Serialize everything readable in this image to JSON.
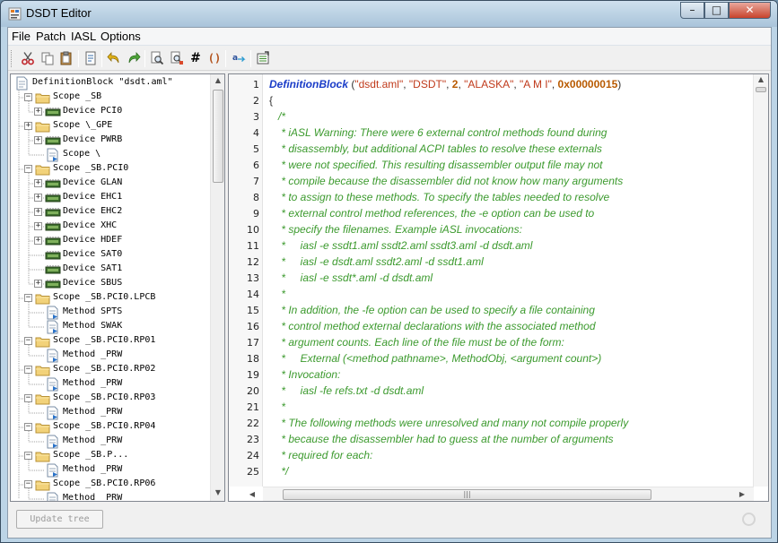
{
  "window": {
    "title": "DSDT Editor",
    "min_glyph": "–",
    "max_glyph": "□",
    "close_glyph": "✕"
  },
  "menu": [
    "File",
    "Patch",
    "IASL",
    "Options"
  ],
  "toolbar": {
    "icons": [
      "cut-icon",
      "copy-icon",
      "paste-icon",
      "compile-icon",
      "undo-icon",
      "redo-icon",
      "find-icon",
      "find-replace-icon",
      "hash-icon",
      "braces-icon",
      "spellcheck-icon",
      "patch-icon"
    ],
    "hash_glyph": "#",
    "braces_glyph": "()"
  },
  "tree": [
    {
      "label": "DefinitionBlock \"dsdt.aml\"",
      "kind": "root",
      "expander": "-"
    },
    {
      "label": "Scope _SB",
      "kind": "folder",
      "expander": "-"
    },
    {
      "label": "Device PCI0",
      "kind": "device",
      "expander": "+"
    },
    {
      "label": "Scope \\_GPE",
      "kind": "folder",
      "expander": "+"
    },
    {
      "label": "Device PWRB",
      "kind": "device",
      "expander": "+"
    },
    {
      "label": "Scope \\",
      "kind": "method",
      "expander": ""
    },
    {
      "label": "Scope _SB.PCI0",
      "kind": "folder",
      "expander": "-"
    },
    {
      "label": "Device GLAN",
      "kind": "device",
      "expander": "+"
    },
    {
      "label": "Device EHC1",
      "kind": "device",
      "expander": "+"
    },
    {
      "label": "Device EHC2",
      "kind": "device",
      "expander": "+"
    },
    {
      "label": "Device XHC",
      "kind": "device",
      "expander": "+"
    },
    {
      "label": "Device HDEF",
      "kind": "device",
      "expander": "+"
    },
    {
      "label": "Device SAT0",
      "kind": "device",
      "expander": ""
    },
    {
      "label": "Device SAT1",
      "kind": "device",
      "expander": ""
    },
    {
      "label": "Device SBUS",
      "kind": "device",
      "expander": "+"
    },
    {
      "label": "Scope _SB.PCI0.LPCB",
      "kind": "folder",
      "expander": "-"
    },
    {
      "label": "Method SPTS",
      "kind": "method",
      "expander": ""
    },
    {
      "label": "Method SWAK",
      "kind": "method",
      "expander": ""
    },
    {
      "label": "Scope _SB.PCI0.RP01",
      "kind": "folder",
      "expander": "-"
    },
    {
      "label": "Method _PRW",
      "kind": "method",
      "expander": ""
    },
    {
      "label": "Scope _SB.PCI0.RP02",
      "kind": "folder",
      "expander": "-"
    },
    {
      "label": "Method _PRW",
      "kind": "method",
      "expander": ""
    },
    {
      "label": "Scope _SB.PCI0.RP03",
      "kind": "folder",
      "expander": "-"
    },
    {
      "label": "Method _PRW",
      "kind": "method",
      "expander": ""
    },
    {
      "label": "Scope _SB.PCI0.RP04",
      "kind": "folder",
      "expander": "-"
    },
    {
      "label": "Method _PRW",
      "kind": "method",
      "expander": ""
    },
    {
      "label": "Scope _SB.P...",
      "kind": "folder",
      "expander": "-"
    },
    {
      "label": "Method _PRW",
      "kind": "method",
      "expander": ""
    },
    {
      "label": "Scope _SB.PCI0.RP06",
      "kind": "folder",
      "expander": "-"
    },
    {
      "label": "Method _PRW",
      "kind": "method",
      "expander": ""
    }
  ],
  "editor": {
    "lines": [
      [
        [
          "kw",
          "DefinitionBlock"
        ],
        [
          "pun",
          " ("
        ],
        [
          "str",
          "\"dsdt.aml\""
        ],
        [
          "pun",
          ", "
        ],
        [
          "str",
          "\"DSDT\""
        ],
        [
          "pun",
          ", "
        ],
        [
          "num",
          "2"
        ],
        [
          "pun",
          ", "
        ],
        [
          "str",
          "\"ALASKA\""
        ],
        [
          "pun",
          ", "
        ],
        [
          "str",
          "\"A M I\""
        ],
        [
          "pun",
          ", "
        ],
        [
          "num",
          "0x00000015"
        ],
        [
          "pun",
          ")"
        ]
      ],
      [
        [
          "pun",
          "{"
        ]
      ],
      [
        [
          "com",
          "   /*"
        ]
      ],
      [
        [
          "com",
          "    * iASL Warning: There were 6 external control methods found during"
        ]
      ],
      [
        [
          "com",
          "    * disassembly, but additional ACPI tables to resolve these externals"
        ]
      ],
      [
        [
          "com",
          "    * were not specified. This resulting disassembler output file may not"
        ]
      ],
      [
        [
          "com",
          "    * compile because the disassembler did not know how many arguments"
        ]
      ],
      [
        [
          "com",
          "    * to assign to these methods. To specify the tables needed to resolve"
        ]
      ],
      [
        [
          "com",
          "    * external control method references, the -e option can be used to"
        ]
      ],
      [
        [
          "com",
          "    * specify the filenames. Example iASL invocations:"
        ]
      ],
      [
        [
          "com",
          "    *     iasl -e ssdt1.aml ssdt2.aml ssdt3.aml -d dsdt.aml"
        ]
      ],
      [
        [
          "com",
          "    *     iasl -e dsdt.aml ssdt2.aml -d ssdt1.aml"
        ]
      ],
      [
        [
          "com",
          "    *     iasl -e ssdt*.aml -d dsdt.aml"
        ]
      ],
      [
        [
          "com",
          "    *"
        ]
      ],
      [
        [
          "com",
          "    * In addition, the -fe option can be used to specify a file containing"
        ]
      ],
      [
        [
          "com",
          "    * control method external declarations with the associated method"
        ]
      ],
      [
        [
          "com",
          "    * argument counts. Each line of the file must be of the form:"
        ]
      ],
      [
        [
          "com",
          "    *     External (<method pathname>, MethodObj, <argument count>)"
        ]
      ],
      [
        [
          "com",
          "    * Invocation:"
        ]
      ],
      [
        [
          "com",
          "    *     iasl -fe refs.txt -d dsdt.aml"
        ]
      ],
      [
        [
          "com",
          "    *"
        ]
      ],
      [
        [
          "com",
          "    * The following methods were unresolved and many not compile properly"
        ]
      ],
      [
        [
          "com",
          "    * because the disassembler had to guess at the number of arguments"
        ]
      ],
      [
        [
          "com",
          "    * required for each:"
        ]
      ],
      [
        [
          "com",
          "    */"
        ]
      ]
    ]
  },
  "bottom": {
    "update_button": "Update tree"
  },
  "colors": {
    "keyword": "#1a3cc8",
    "string": "#c03a1b",
    "number": "#b85a00",
    "comment": "#3c9a2e"
  }
}
